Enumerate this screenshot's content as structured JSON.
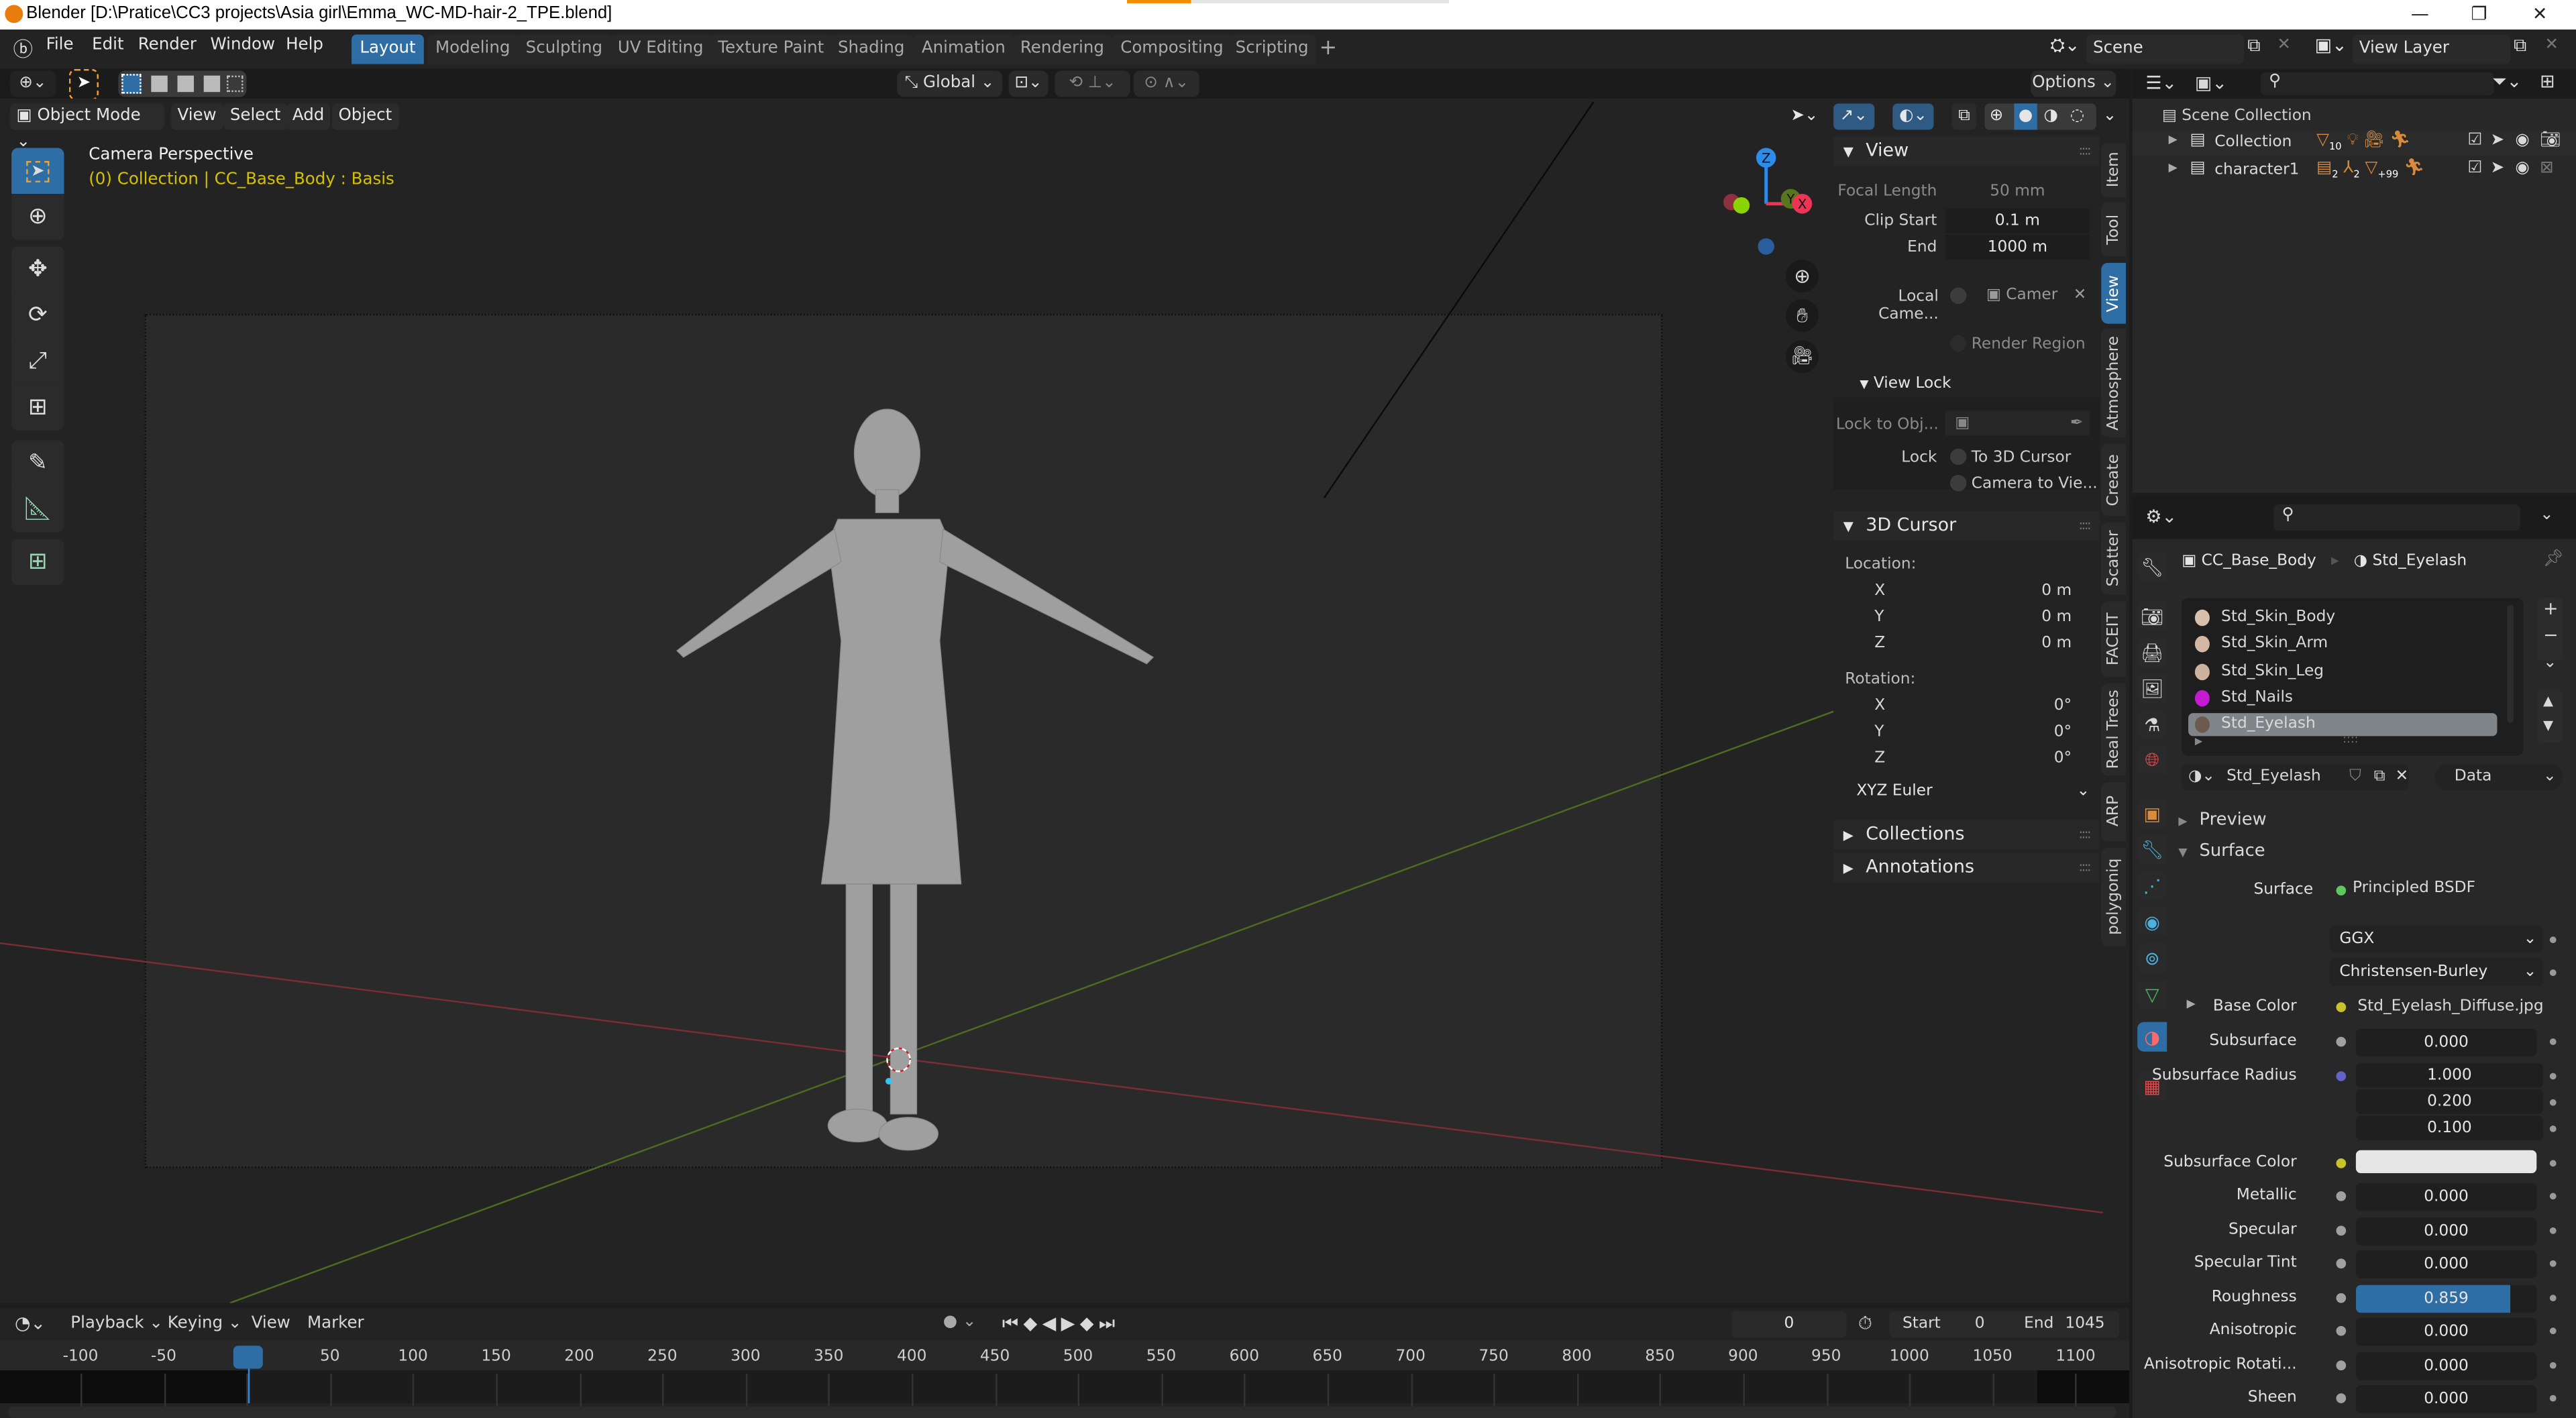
{
  "titlebar": {
    "title": "Blender [D:\\Pratice\\CC3 projects\\Asia girl\\Emma_WC-MD-hair-2_TPE.blend]",
    "minimize": "—",
    "maximize": "❐",
    "close": "✕"
  },
  "menubar": {
    "items": [
      "File",
      "Edit",
      "Render",
      "Window",
      "Help"
    ],
    "workspaces": [
      "Layout",
      "Modeling",
      "Sculpting",
      "UV Editing",
      "Texture Paint",
      "Shading",
      "Animation",
      "Rendering",
      "Compositing",
      "Scripting"
    ],
    "active_workspace": "Layout",
    "add_workspace": "+",
    "scene_label": "Scene",
    "view_layer_label": "View Layer"
  },
  "tool_header": {
    "orientation": "Global",
    "options": "Options"
  },
  "viewport_header": {
    "mode": "Object Mode",
    "menus": [
      "View",
      "Select",
      "Add",
      "Object"
    ]
  },
  "viewport": {
    "camera_label": "Camera Perspective",
    "object_info": "(0) Collection | CC_Base_Body : Basis",
    "info_color": "#d4c200",
    "gizmo": {
      "z": "Z",
      "y": "Y",
      "x": "X"
    }
  },
  "npanel": {
    "view": {
      "title": "View",
      "focal_length_label": "Focal Length",
      "focal_length": "50 mm",
      "clip_start_label": "Clip Start",
      "clip_start": "0.1 m",
      "end_label": "End",
      "end": "1000 m",
      "local_camera_label": "Local Came...",
      "local_camera_value": "Camer",
      "render_region": "Render Region"
    },
    "view_lock": {
      "title": "View Lock",
      "lock_to_object_label": "Lock to Obj...",
      "lock_label": "Lock",
      "to_3d_cursor": "To 3D Cursor",
      "camera_to_view": "Camera to Vie..."
    },
    "cursor": {
      "title": "3D Cursor",
      "location_label": "Location:",
      "location": [
        {
          "axis": "X",
          "value": "0 m"
        },
        {
          "axis": "Y",
          "value": "0 m"
        },
        {
          "axis": "Z",
          "value": "0 m"
        }
      ],
      "rotation_label": "Rotation:",
      "rotation": [
        {
          "axis": "X",
          "value": "0°"
        },
        {
          "axis": "Y",
          "value": "0°"
        },
        {
          "axis": "Z",
          "value": "0°"
        }
      ],
      "rotation_mode": "XYZ Euler"
    },
    "collections": "Collections",
    "annotations": "Annotations",
    "tabs": [
      "Item",
      "Tool",
      "View",
      "Atmosphere",
      "Create",
      "Scatter",
      "FACEIT",
      "Real Trees",
      "ARP",
      "polygoniq"
    ],
    "active_tab": "View"
  },
  "outliner": {
    "scene_collection": "Scene Collection",
    "rows": [
      {
        "name": "Collection",
        "badge": "10"
      },
      {
        "name": "character1",
        "badges": [
          "2",
          "2",
          "+99"
        ]
      }
    ]
  },
  "properties": {
    "breadcrumb_object": "CC_Base_Body",
    "breadcrumb_material": "Std_Eyelash",
    "materials": [
      {
        "name": "Std_Skin_Body",
        "color": "#d9c0ac"
      },
      {
        "name": "Std_Skin_Arm",
        "color": "#d2b8a2"
      },
      {
        "name": "Std_Skin_Leg",
        "color": "#cdb39e"
      },
      {
        "name": "Std_Nails",
        "color": "#c21bd0"
      },
      {
        "name": "Std_Eyelash",
        "color": "#6b5a4d",
        "selected": true
      }
    ],
    "material_name": "Std_Eyelash",
    "link": "Data",
    "preview": "Preview",
    "surface_panel": "Surface",
    "surface_label": "Surface",
    "surface_shader": "Principled BSDF",
    "distribution": "GGX",
    "subsurface_method": "Christensen-Burley",
    "inputs": [
      {
        "label": "Base Color",
        "value": "Std_Eyelash_Diffuse.jpg",
        "socket": "#c8c32a"
      },
      {
        "label": "Subsurface",
        "value": "0.000",
        "socket": "#a0a0a0"
      },
      {
        "label": "Subsurface Radius",
        "values": [
          "1.000",
          "0.200",
          "0.100"
        ],
        "socket": "#6363c7"
      },
      {
        "label": "Subsurface Color",
        "value": "",
        "socket": "#c8c32a",
        "swatch": "#e6e6e6"
      },
      {
        "label": "Metallic",
        "value": "0.000",
        "socket": "#a0a0a0"
      },
      {
        "label": "Specular",
        "value": "0.000",
        "socket": "#a0a0a0"
      },
      {
        "label": "Specular Tint",
        "value": "0.000",
        "socket": "#a0a0a0"
      },
      {
        "label": "Roughness",
        "value": "0.859",
        "fraction": 0.859,
        "socket": "#a0a0a0"
      },
      {
        "label": "Anisotropic",
        "value": "0.000",
        "socket": "#a0a0a0"
      },
      {
        "label": "Anisotropic Rotati...",
        "value": "0.000",
        "socket": "#a0a0a0"
      },
      {
        "label": "Sheen",
        "value": "0.000",
        "socket": "#a0a0a0"
      }
    ]
  },
  "timeline": {
    "menus": [
      "Playback",
      "Keying",
      "View",
      "Marker"
    ],
    "current_frame": "0",
    "start_label": "Start",
    "start": "0",
    "end_label": "End",
    "end": "1045",
    "ticks": [
      "-100",
      "-50",
      "0",
      "50",
      "100",
      "150",
      "200",
      "250",
      "300",
      "350",
      "400",
      "450",
      "500",
      "550",
      "600",
      "650",
      "700",
      "750",
      "800",
      "850",
      "900",
      "950",
      "1000",
      "1050",
      "1100"
    ]
  },
  "colors": {
    "accent": "#2f6ea4",
    "panel": "#282828",
    "viewport": "#232323"
  }
}
